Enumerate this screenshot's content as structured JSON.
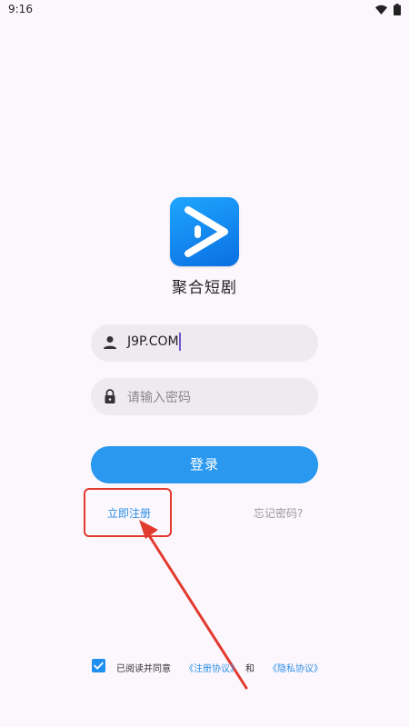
{
  "status": {
    "time": "9:16"
  },
  "app": {
    "name": "聚合短剧"
  },
  "form": {
    "username_value": "J9P.COM",
    "password_placeholder": "请输入密码",
    "login_label": "登录"
  },
  "links": {
    "register": "立即注册",
    "forgot": "忘记密码?"
  },
  "agreement": {
    "text": "已阅读并同意",
    "terms": "《注册协议》",
    "and": "和",
    "privacy": "《隐私协议》",
    "checked": true
  },
  "colors": {
    "accent": "#2b98ef",
    "link": "#2b8fe6",
    "annotation": "#e23a2f"
  },
  "icons": {
    "wifi": "wifi-icon",
    "battery": "battery-icon",
    "user": "person-icon",
    "lock": "lock-icon",
    "logo": "play-icon",
    "check": "checkmark-icon"
  }
}
